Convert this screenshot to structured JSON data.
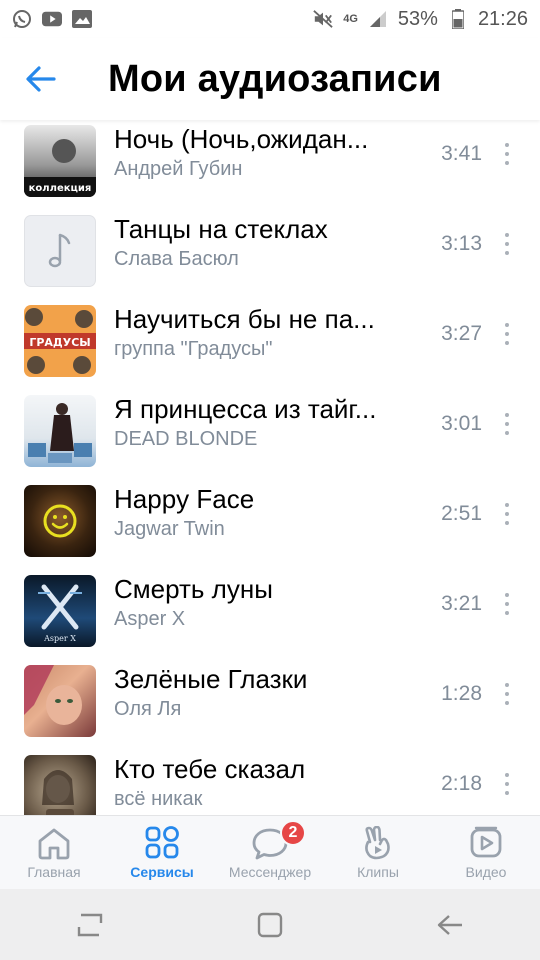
{
  "status_bar": {
    "battery": "53%",
    "time": "21:26",
    "network": "4G",
    "left_icons": [
      "whatsapp-icon",
      "youtube-icon",
      "gallery-icon"
    ],
    "right_icons": [
      "mute-icon",
      "signal-icon",
      "battery-icon"
    ]
  },
  "header": {
    "title": "Мои аудиозаписи",
    "back_icon": "back-arrow-icon"
  },
  "tracks": [
    {
      "title": "Ночь (Ночь,ожидан...",
      "artist": "Андрей Губин",
      "duration": "3:41",
      "cover": "album-art",
      "cover_text": "коллекция"
    },
    {
      "title": "Танцы на стеклах",
      "artist": "Слава Басюл",
      "duration": "3:13",
      "cover": "music-note-placeholder"
    },
    {
      "title": "Научиться бы не па...",
      "artist": "группа \"Градусы\"",
      "duration": "3:27",
      "cover": "album-art",
      "cover_text": "ГРАДУСЫ"
    },
    {
      "title": "Я принцесса из тайг...",
      "artist": "DEAD BLONDE",
      "duration": "3:01",
      "cover": "album-art"
    },
    {
      "title": "Happy Face",
      "artist": "Jagwar Twin",
      "duration": "2:51",
      "cover": "album-art"
    },
    {
      "title": "Смерть луны",
      "artist": "Asper X",
      "duration": "3:21",
      "cover": "album-art",
      "cover_text": "Asper X"
    },
    {
      "title": "Зелёные Глазки",
      "artist": "Оля Ля",
      "duration": "1:28",
      "cover": "album-art"
    },
    {
      "title": "Кто тебе сказал",
      "artist": "всё никак",
      "duration": "2:18",
      "cover": "album-art"
    }
  ],
  "tabbar": {
    "tabs": [
      {
        "label": "Главная",
        "icon": "home-icon",
        "active": false
      },
      {
        "label": "Сервисы",
        "icon": "services-icon",
        "active": true
      },
      {
        "label": "Мессенджер",
        "icon": "messenger-icon",
        "active": false,
        "badge": "2"
      },
      {
        "label": "Клипы",
        "icon": "clips-icon",
        "active": false
      },
      {
        "label": "Видео",
        "icon": "video-icon",
        "active": false
      }
    ]
  },
  "colors": {
    "accent": "#2688eb",
    "secondary_text": "#818c99",
    "badge": "#e64646"
  }
}
